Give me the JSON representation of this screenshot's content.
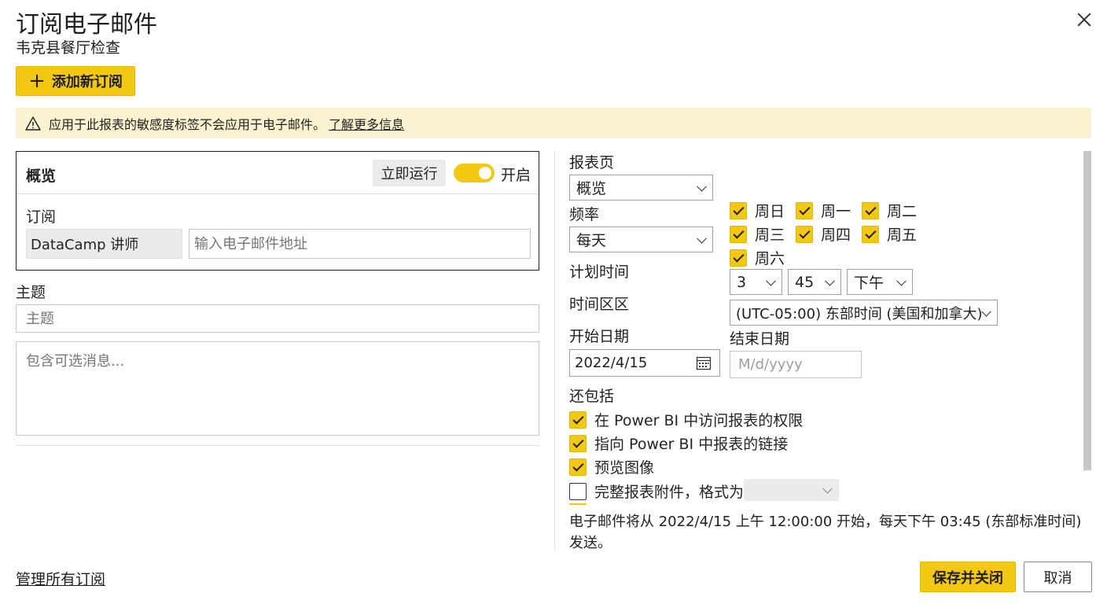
{
  "dialog": {
    "title": "订阅电子邮件",
    "subtitle": "韦克县餐厅检查",
    "add_button": "添加新订阅",
    "banner_text": "应用于此报表的敏感度标签不会应用于电子邮件。",
    "banner_link": "了解更多信息"
  },
  "card": {
    "title": "概览",
    "run_now": "立即运行",
    "toggle_label": "开启",
    "toggle_on": true,
    "subscribe_label": "订阅",
    "recipient": "DataCamp 讲师",
    "email_placeholder": "输入电子邮件地址"
  },
  "subject": {
    "label": "主题",
    "placeholder": "主题",
    "message_placeholder": "包含可选消息..."
  },
  "schedule": {
    "report_page_label": "报表页",
    "report_page_value": "概览",
    "frequency_label": "频率",
    "frequency_value": "每天",
    "days": [
      {
        "label": "周日",
        "checked": true
      },
      {
        "label": "周一",
        "checked": true
      },
      {
        "label": "周二",
        "checked": true
      },
      {
        "label": "周三",
        "checked": true
      },
      {
        "label": "周四",
        "checked": true
      },
      {
        "label": "周五",
        "checked": true
      },
      {
        "label": "周六",
        "checked": true
      }
    ],
    "time_label": "计划时间",
    "hour": "3",
    "minute": "45",
    "ampm": "下午",
    "timezone_label": "时间区区",
    "timezone_value": "(UTC-05:00) 东部时间 (美国和加拿大)",
    "start_label": "开始日期",
    "start_value": "2022/4/15",
    "end_label": "结束日期",
    "end_placeholder": "M/d/yyyy"
  },
  "include": {
    "label": "还包括",
    "options": [
      {
        "label": "在 Power BI 中访问报表的权限",
        "checked": true
      },
      {
        "label": "指向 Power BI 中报表的链接",
        "checked": true
      },
      {
        "label": "预览图像",
        "checked": true
      },
      {
        "label": "完整报表附件，格式为",
        "checked": false
      }
    ]
  },
  "summary_text": "电子邮件将从 2022/4/15 上午 12:00:00 开始，每天下午 03:45 (东部标准时间) 发送。",
  "footer": {
    "manage_link": "管理所有订阅",
    "save_button": "保存并关闭",
    "cancel_button": "取消"
  },
  "colors": {
    "accent": "#f2c811",
    "banner_bg": "#fbf3cf",
    "border": "#c8c6c4"
  }
}
